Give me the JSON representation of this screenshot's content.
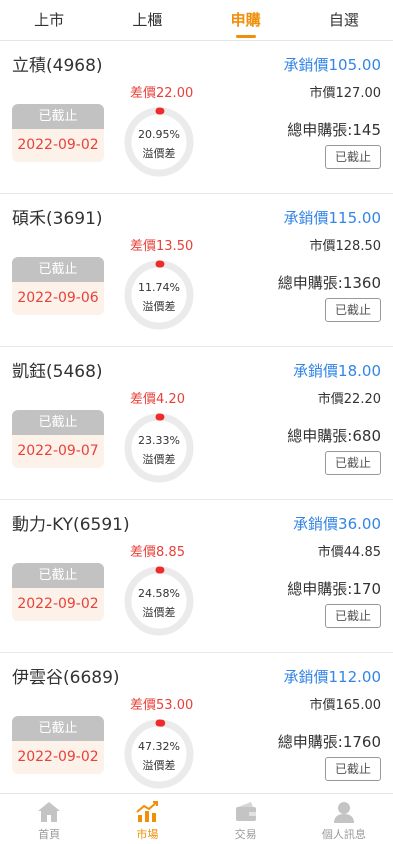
{
  "tabs": [
    {
      "label": "上市",
      "active": false
    },
    {
      "label": "上櫃",
      "active": false
    },
    {
      "label": "申購",
      "active": true
    },
    {
      "label": "自選",
      "active": false
    }
  ],
  "items": [
    {
      "name": "立積(4968)",
      "diff_label": "差價",
      "diff": "22.00",
      "status": "已截止",
      "date": "2022-09-02",
      "pct": "20.95%",
      "pct_value": 0.2095,
      "gauge_label": "溢價差",
      "uw_label": "承銷價",
      "uw_price": "105.00",
      "mk_label": "市價",
      "mk_price": "127.00",
      "total_label": "總申購張:",
      "total": "145",
      "button": "已截止"
    },
    {
      "name": "碩禾(3691)",
      "diff_label": "差價",
      "diff": "13.50",
      "status": "已截止",
      "date": "2022-09-06",
      "pct": "11.74%",
      "pct_value": 0.1174,
      "gauge_label": "溢價差",
      "uw_label": "承銷價",
      "uw_price": "115.00",
      "mk_label": "市價",
      "mk_price": "128.50",
      "total_label": "總申購張:",
      "total": "1360",
      "button": "已截止"
    },
    {
      "name": "凱鈺(5468)",
      "diff_label": "差價",
      "diff": "4.20",
      "status": "已截止",
      "date": "2022-09-07",
      "pct": "23.33%",
      "pct_value": 0.2333,
      "gauge_label": "溢價差",
      "uw_label": "承銷價",
      "uw_price": "18.00",
      "mk_label": "市價",
      "mk_price": "22.20",
      "total_label": "總申購張:",
      "total": "680",
      "button": "已截止"
    },
    {
      "name": "動力-KY(6591)",
      "diff_label": "差價",
      "diff": "8.85",
      "status": "已截止",
      "date": "2022-09-02",
      "pct": "24.58%",
      "pct_value": 0.2458,
      "gauge_label": "溢價差",
      "uw_label": "承銷價",
      "uw_price": "36.00",
      "mk_label": "市價",
      "mk_price": "44.85",
      "total_label": "總申購張:",
      "total": "170",
      "button": "已截止"
    },
    {
      "name": "伊雲谷(6689)",
      "diff_label": "差價",
      "diff": "53.00",
      "status": "已截止",
      "date": "2022-09-02",
      "pct": "47.32%",
      "pct_value": 0.4732,
      "gauge_label": "溢價差",
      "uw_label": "承銷價",
      "uw_price": "112.00",
      "mk_label": "市價",
      "mk_price": "165.00",
      "total_label": "總申購張:",
      "total": "1760",
      "button": "已截止"
    }
  ],
  "nav": [
    {
      "label": "首頁",
      "icon": "home-icon",
      "active": false
    },
    {
      "label": "市場",
      "icon": "market-chart-icon",
      "active": true
    },
    {
      "label": "交易",
      "icon": "wallet-icon",
      "active": false
    },
    {
      "label": "個人訊息",
      "icon": "user-icon",
      "active": false
    }
  ],
  "colors": {
    "accent": "#f0900a",
    "blue": "#3385e6",
    "red": "#e8413a",
    "gauge_track": "#ebebeb",
    "gauge_dot": "#ee2a2a",
    "status_gray": "#c2c2c2",
    "inactive": "#bbbbbb"
  }
}
